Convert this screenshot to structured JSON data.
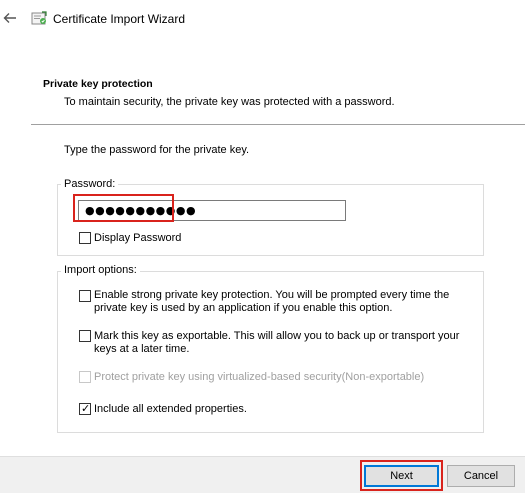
{
  "window": {
    "title": "Certificate Import Wizard"
  },
  "header": {
    "section_title": "Private key protection",
    "section_description": "To maintain security, the private key was protected with a password."
  },
  "password_section": {
    "instruction": "Type the password for the private key.",
    "label": "Password:",
    "value": "●●●●●●●●●●●",
    "display_password": {
      "label": "Display Password",
      "checked": false
    }
  },
  "import_options": {
    "label": "Import options:",
    "options": [
      {
        "line1": "Enable strong private key protection. You will be prompted every time the",
        "line2": "private key is used by an application if you enable this option.",
        "checked": false,
        "enabled": true
      },
      {
        "line1": "Mark this key as exportable. This will allow you to back up or transport your",
        "line2": "keys at a later time.",
        "checked": false,
        "enabled": true
      },
      {
        "line1": "Protect private key using virtualized-based security(Non-exportable)",
        "line2": "",
        "checked": false,
        "enabled": false
      },
      {
        "line1": "Include all extended properties.",
        "line2": "",
        "checked": true,
        "enabled": true
      }
    ]
  },
  "footer": {
    "next_label": "Next",
    "cancel_label": "Cancel"
  },
  "colors": {
    "highlight": "#d9231c",
    "accent": "#0078d7"
  }
}
